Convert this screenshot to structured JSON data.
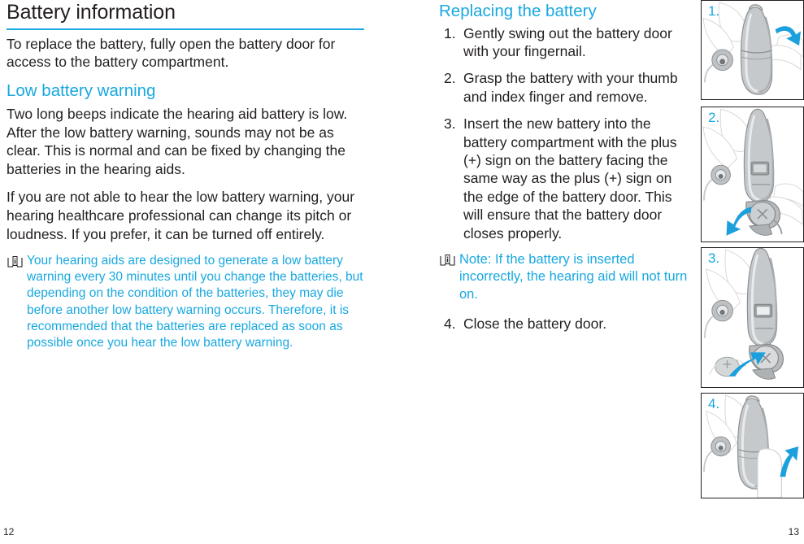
{
  "document": {
    "left_page": {
      "title": "Battery information",
      "intro": "To replace the battery, fully open the battery door for access to the battery compartment.",
      "section_heading": "Low battery warning",
      "paragraphs": [
        "Two long beeps indicate the hearing aid battery is low. After the low battery warning, sounds may not be as clear. This is normal and can be fixed by changing the batteries in the hearing aids.",
        "If you are not able to hear the low battery warning, your hearing healthcare professional can change its pitch or loudness. If you prefer, it can be turned off entirely."
      ],
      "note": "Your hearing aids are designed to generate a low battery warning every 30 minutes until you change the batteries, but depending on the condition of the batteries, they may die before another low battery warning occurs. Therefore, it is recommended that the batteries are replaced as soon as possible once you hear the low battery warning.",
      "note_icon": "instructions-for-use-icon",
      "page_number": "12"
    },
    "right_page": {
      "heading": "Replacing the battery",
      "steps": [
        {
          "num": "1.",
          "text": "Gently swing out the battery door with your fingernail."
        },
        {
          "num": "2.",
          "text": "Grasp the battery with your thumb and index finger and remove."
        },
        {
          "num": "3.",
          "text": "Insert the new battery into the battery compartment with the plus (+) sign on the battery facing the same way as the plus (+) sign on the edge of the battery door. This will ensure that the battery door closes properly."
        }
      ],
      "note": "Note: If the battery is inserted incorrectly, the hearing aid will not turn on.",
      "note_icon": "instructions-for-use-icon",
      "final_step": {
        "num": "4.",
        "text": "Close the battery door."
      },
      "page_number": "13"
    },
    "figures": [
      {
        "label": "1.",
        "caption": "hearing-aid-swing-out-battery-door"
      },
      {
        "label": "2.",
        "caption": "hearing-aid-remove-battery"
      },
      {
        "label": "3.",
        "caption": "hearing-aid-insert-new-battery"
      },
      {
        "label": "4.",
        "caption": "hearing-aid-close-battery-door"
      }
    ]
  },
  "colors": {
    "accent": "#18a8e0",
    "text": "#231f20",
    "background": "#ffffff"
  }
}
